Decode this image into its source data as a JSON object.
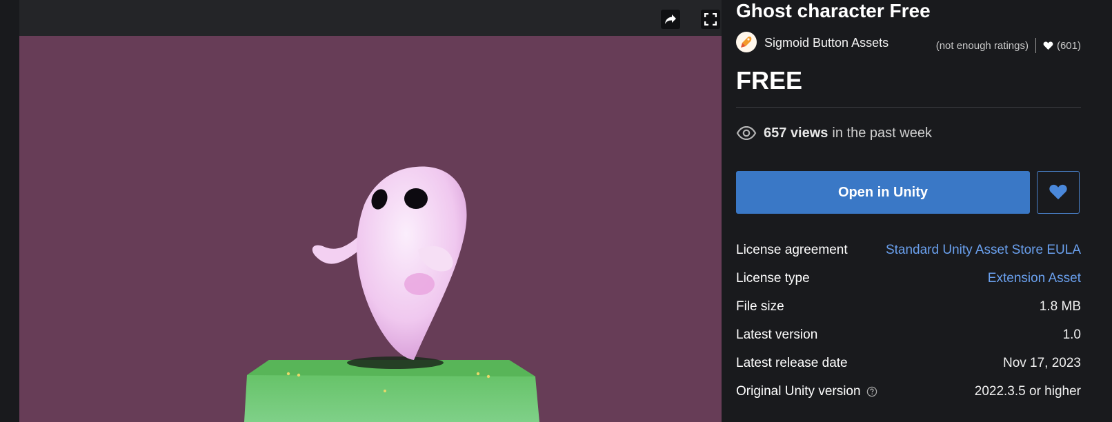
{
  "viewer": {
    "share_icon": "share-arrow-icon",
    "fullscreen_icon": "fullscreen-icon",
    "background_color": "#673d57"
  },
  "product": {
    "title": "Ghost character Free",
    "publisher": "Sigmoid Button Assets",
    "ratings_text": "(not enough ratings)",
    "favorites_count": "(601)",
    "price": "FREE",
    "views_count": "657 views",
    "views_suffix": "in the past week",
    "open_button_label": "Open in Unity"
  },
  "details": [
    {
      "label": "License agreement",
      "value": "Standard Unity Asset Store EULA",
      "is_link": true
    },
    {
      "label": "License type",
      "value": "Extension Asset",
      "is_link": true
    },
    {
      "label": "File size",
      "value": "1.8 MB",
      "is_link": false
    },
    {
      "label": "Latest version",
      "value": "1.0",
      "is_link": false
    },
    {
      "label": "Latest release date",
      "value": "Nov 17, 2023",
      "is_link": false
    },
    {
      "label": "Original Unity version",
      "value": "2022.3.5 or higher",
      "is_link": false,
      "has_help": true
    }
  ],
  "colors": {
    "accent_button": "#3a78c6",
    "link": "#6aa0ee",
    "page_background": "#191a1d"
  }
}
